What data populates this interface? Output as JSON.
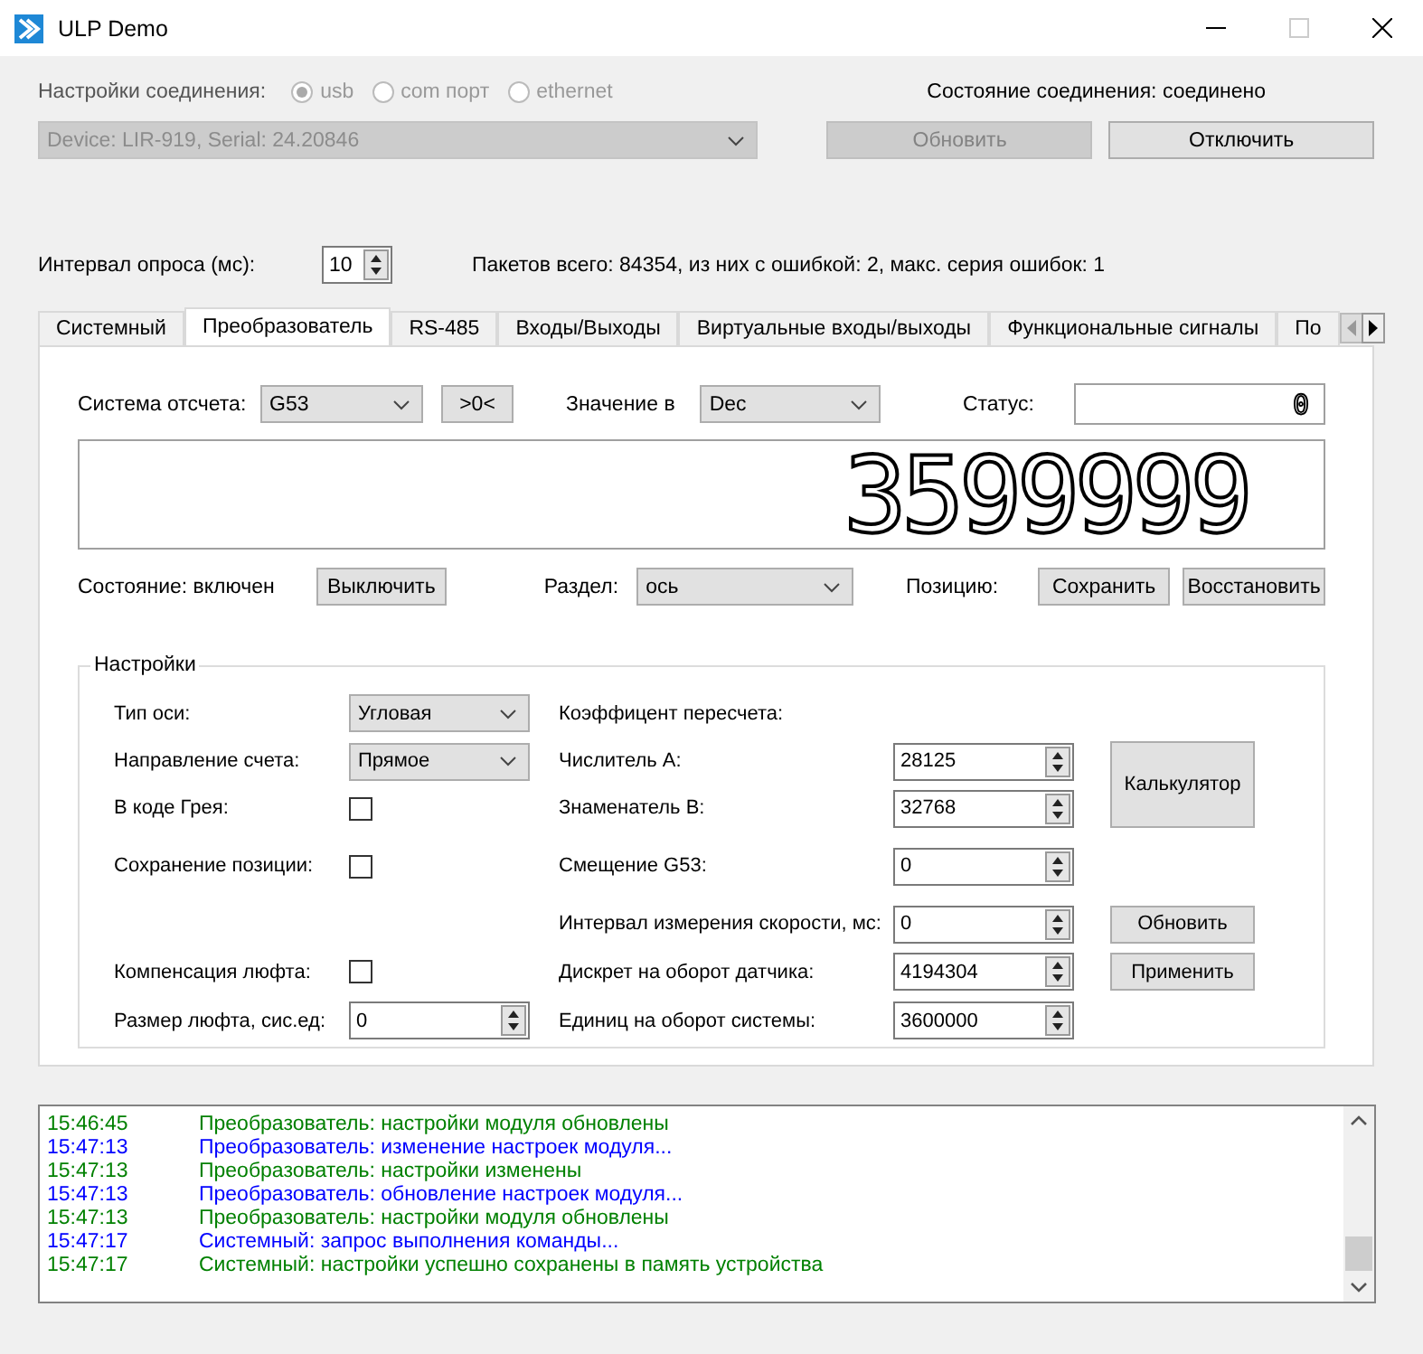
{
  "window": {
    "title": "ULP Demo"
  },
  "connection": {
    "label": "Настройки соединения:",
    "options": [
      {
        "label": "usb",
        "selected": true
      },
      {
        "label": "com порт",
        "selected": false
      },
      {
        "label": "ethernet",
        "selected": false
      }
    ],
    "status": "Состояние соединения: соединено",
    "device": "Device: LIR-919, Serial: 24.20846",
    "device_disabled": true,
    "buttons": [
      {
        "label": "Обновить",
        "disabled": true
      },
      {
        "label": "Отключить",
        "disabled": false
      }
    ]
  },
  "polling": {
    "label": "Интервал опроса (мс):",
    "value": "10",
    "stats": "Пакетов всего: 84354, из них с ошибкой: 2, макс. серия ошибок: 1"
  },
  "tabs": [
    {
      "label": "Системный",
      "selected": false
    },
    {
      "label": "Преобразователь",
      "selected": true
    },
    {
      "label": "RS-485",
      "selected": false
    },
    {
      "label": "Входы/Выходы",
      "selected": false
    },
    {
      "label": "Виртуальные входы/выходы",
      "selected": false
    },
    {
      "label": "Функциональные сигналы",
      "selected": false
    },
    {
      "label": "По",
      "selected": false
    }
  ],
  "panel": {
    "reference_label": "Система отсчета:",
    "reference": "G53",
    "zero_button": ">0<",
    "value_in_label": "Значение в",
    "value_in": "Dec",
    "status_label": "Статус:",
    "status_value": "0",
    "display": "3599999",
    "state_label": "Состояние: включен",
    "state_button": "Выключить",
    "section_label": "Раздел:",
    "section": "ось",
    "position_label": "Позицию:",
    "position_buttons": [
      "Сохранить",
      "Восстановить"
    ],
    "settings": {
      "title": "Настройки",
      "left": [
        {
          "kind": "combo",
          "label": "Тип оси:",
          "value": "Угловая"
        },
        {
          "kind": "combo",
          "label": "Направление счета:",
          "value": "Прямое"
        },
        {
          "kind": "checkbox",
          "label": "В коде Грея:",
          "checked": false
        },
        {
          "kind": "checkbox",
          "label": "Сохранение позиции:",
          "checked": false
        },
        {
          "kind": "checkbox",
          "label": "Компенсация люфта:",
          "checked": false
        },
        {
          "kind": "spin",
          "label": "Размер люфта, сис.ед:",
          "value": "0"
        }
      ],
      "right": [
        {
          "kind": "heading",
          "label": "Коэффицент пересчета:"
        },
        {
          "kind": "spin",
          "label": "Числитель A:",
          "value": "28125"
        },
        {
          "kind": "spin",
          "label": "Знаменатель B:",
          "value": "32768"
        },
        {
          "kind": "spin",
          "label": "Смещение G53:",
          "value": "0"
        },
        {
          "kind": "spin",
          "label": "Интервал измерения скорости, мс:",
          "value": "0"
        },
        {
          "kind": "spin",
          "label": "Дискрет на оборот датчика:",
          "value": "4194304"
        },
        {
          "kind": "spin",
          "label": "Единиц на оборот системы:",
          "value": "3600000"
        }
      ],
      "buttons": [
        "Калькулятор",
        "Обновить",
        "Применить"
      ]
    }
  },
  "log": [
    {
      "time": "15:46:45",
      "message": "Преобразователь:  настройки модуля обновлены",
      "color": "#008000"
    },
    {
      "time": "15:47:13",
      "message": "Преобразователь:  изменение настроек модуля...",
      "color": "#0000ff"
    },
    {
      "time": "15:47:13",
      "message": "Преобразователь:  настройки изменены",
      "color": "#008000"
    },
    {
      "time": "15:47:13",
      "message": "Преобразователь:  обновление настроек модуля...",
      "color": "#0000ff"
    },
    {
      "time": "15:47:13",
      "message": "Преобразователь:  настройки модуля обновлены",
      "color": "#008000"
    },
    {
      "time": "15:47:17",
      "message": "Системный:  запрос выполнения команды...",
      "color": "#0000ff"
    },
    {
      "time": "15:47:17",
      "message": "Системный:  настройки успешно сохранены в память устройства",
      "color": "#008000"
    }
  ]
}
